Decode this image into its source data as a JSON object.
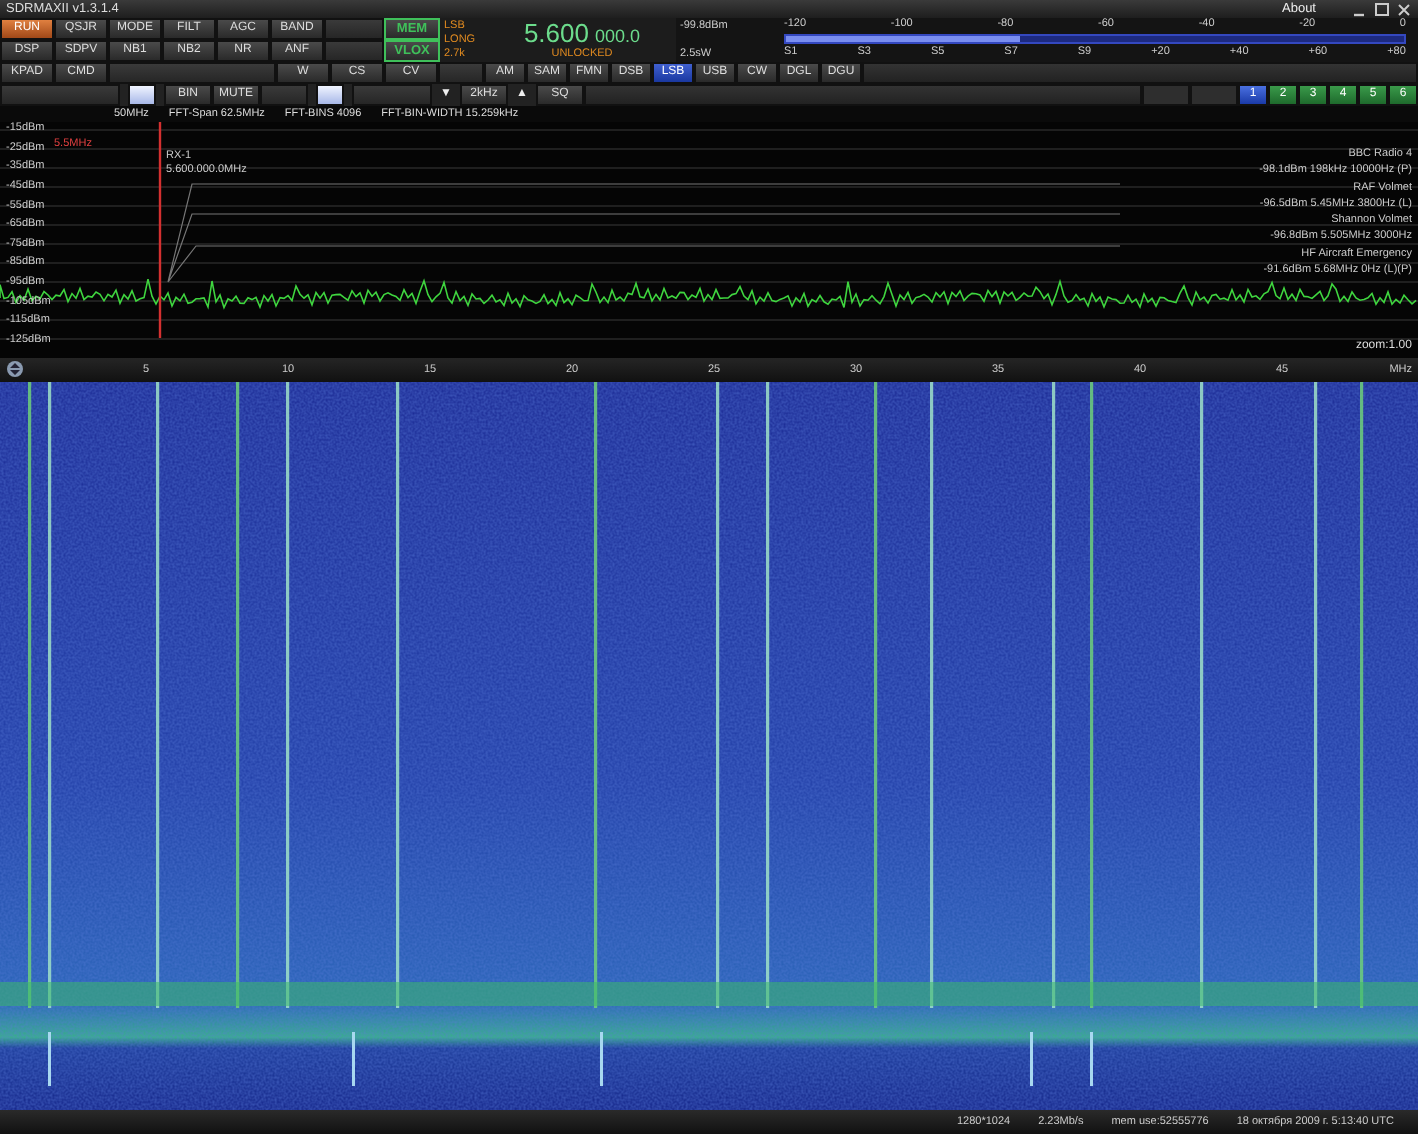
{
  "window": {
    "title": "SDRMAXII v1.3.1.4",
    "menu": "About"
  },
  "toolbar": {
    "rows": [
      [
        {
          "kind": "button",
          "label": "RUN",
          "selected": true
        },
        {
          "kind": "button",
          "label": "QSJR",
          "selected": false
        },
        {
          "kind": "button",
          "label": "MODE",
          "selected": false
        },
        {
          "kind": "button",
          "label": "FILT",
          "selected": false
        },
        {
          "kind": "button",
          "label": "AGC",
          "selected": false
        },
        {
          "kind": "button",
          "label": "BAND",
          "selected": false
        },
        {
          "kind": "blank"
        },
        {
          "kind": "button",
          "label": "MEM",
          "selected": false,
          "color": "#3fc05a"
        }
      ],
      [
        {
          "kind": "button",
          "label": "DSP",
          "selected": false
        },
        {
          "kind": "button",
          "label": "SDPV",
          "selected": false
        },
        {
          "kind": "button",
          "label": "NB1",
          "selected": false
        },
        {
          "kind": "button",
          "label": "NB2",
          "selected": false
        },
        {
          "kind": "button",
          "label": "NR",
          "selected": false
        },
        {
          "kind": "button",
          "label": "ANF",
          "selected": false
        },
        {
          "kind": "blank"
        },
        {
          "kind": "button",
          "label": "VLOX",
          "selected": false,
          "color": "#3fc05a"
        }
      ]
    ]
  },
  "frequency": {
    "mode": "LSB",
    "agc": "LONG",
    "filter": "2.7k",
    "main": "5.600",
    "fine": "000.0",
    "lock": "UNLOCKED"
  },
  "s_meter": {
    "reading": "-99.8dBm",
    "power": "2.5sW",
    "level": 0.38,
    "top_scale": [
      "-120",
      "-100",
      "-80",
      "-60",
      "-40",
      "-20",
      "0"
    ],
    "bottom_scale": [
      "S1",
      "S3",
      "S5",
      "S7",
      "S9",
      "+20",
      "+40",
      "+60",
      "+80"
    ]
  },
  "control_row": [
    {
      "kind": "button",
      "label": "KPAD"
    },
    {
      "kind": "button",
      "label": "CMD"
    },
    {
      "kind": "blank"
    },
    {
      "kind": "button",
      "label": "W"
    },
    {
      "kind": "button",
      "label": "CS"
    },
    {
      "kind": "button",
      "label": "CV"
    },
    {
      "kind": "blank"
    }
  ],
  "modes": [
    {
      "label": "AM",
      "selected": false
    },
    {
      "label": "SAM",
      "selected": false
    },
    {
      "label": "FMN",
      "selected": false
    },
    {
      "label": "DSB",
      "selected": false
    },
    {
      "label": "LSB",
      "selected": true
    },
    {
      "label": "USB",
      "selected": false
    },
    {
      "label": "CW",
      "selected": false
    },
    {
      "label": "DGL",
      "selected": false
    },
    {
      "label": "DGU",
      "selected": false
    }
  ],
  "audio_row": [
    {
      "kind": "blank"
    },
    {
      "kind": "toggle",
      "on": true
    },
    {
      "kind": "button",
      "label": "BIN"
    },
    {
      "kind": "button",
      "label": "MUTE"
    },
    {
      "kind": "blank"
    },
    {
      "kind": "toggle",
      "on": true
    },
    {
      "kind": "blank"
    },
    {
      "kind": "arrow",
      "label": "▼"
    },
    {
      "kind": "button",
      "label": "2kHz"
    },
    {
      "kind": "arrow",
      "label": "▲"
    },
    {
      "kind": "button",
      "label": "SQ"
    }
  ],
  "receivers": [
    {
      "label": "1",
      "selected": true
    },
    {
      "label": "2",
      "selected": false
    },
    {
      "label": "3",
      "selected": false
    },
    {
      "label": "4",
      "selected": false
    },
    {
      "label": "5",
      "selected": false
    },
    {
      "label": "6",
      "selected": false
    }
  ],
  "fft_info": [
    "50MHz",
    "FFT-Span 62.5MHz",
    "FFT-BINS 4096",
    "FFT-BIN-WIDTH 15.259kHz"
  ],
  "spectrum": {
    "dbm_labels": [
      "-15dBm",
      "-25dBm",
      "-35dBm",
      "-45dBm",
      "-55dBm",
      "-65dBm",
      "-75dBm",
      "-85dBm",
      "-95dBm",
      "-105dBm",
      "-115dBm",
      "-125dBm"
    ],
    "marker_label": "5.5MHz",
    "rx_name": "RX-1",
    "rx_frequency": "5.600.000.0MHz",
    "stations": [
      {
        "name": "BBC Radio 4",
        "reading": "-98.1dBm 198kHz 10000Hz (P)"
      },
      {
        "name": "RAF Volmet",
        "reading": "-96.5dBm 5.45MHz 3800Hz (L)"
      },
      {
        "name": "Shannon Volmet",
        "reading": "-96.8dBm 5.505MHz 3000Hz"
      },
      {
        "name": "HF Aircraft Emergency",
        "reading": "-91.6dBm 5.68MHz 0Hz (L)(P)"
      }
    ],
    "zoom": "zoom:1.00"
  },
  "axis": {
    "labels": [
      "5",
      "10",
      "15",
      "20",
      "25",
      "30",
      "35",
      "40",
      "45"
    ],
    "unit": "MHz"
  },
  "status_bar": [
    "1280*1024",
    "2.23Mb/s",
    "mem use:52555776",
    "18 октября 2009 г. 5:13:40 UTC"
  ]
}
